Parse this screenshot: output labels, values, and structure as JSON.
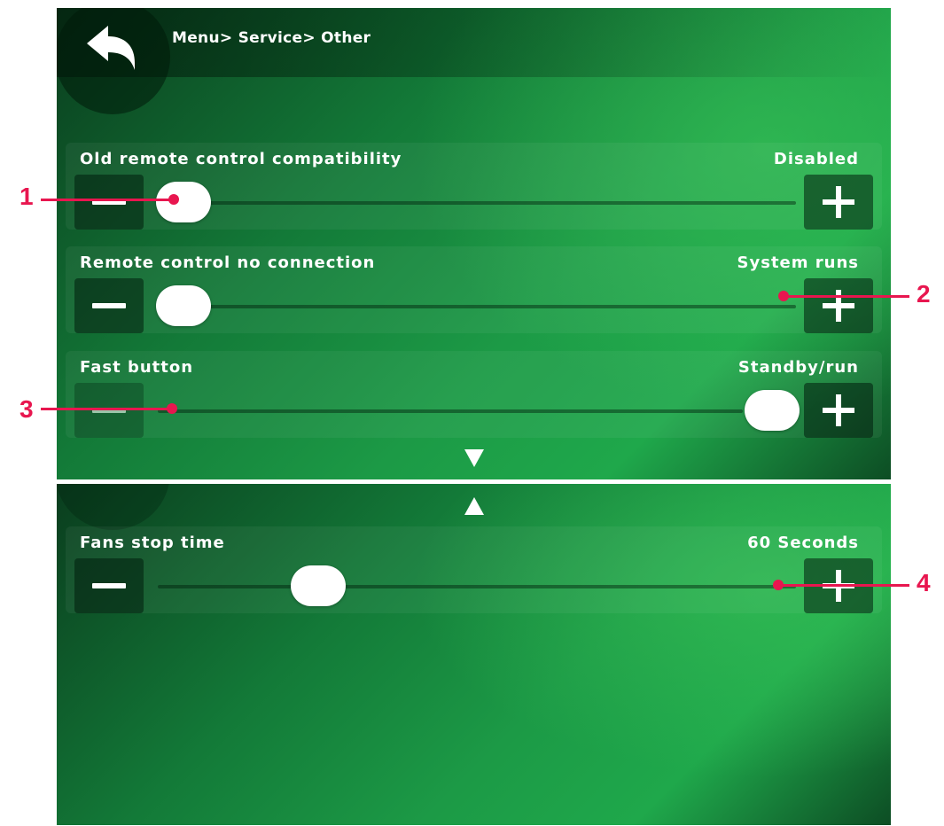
{
  "header": {
    "breadcrumb": "Menu> Service> Other"
  },
  "settings": [
    {
      "label": "Old remote control compatibility",
      "value": "Disabled"
    },
    {
      "label": "Remote control no connection",
      "value": "System runs"
    },
    {
      "label": "Fast button",
      "value": "Standby/run"
    },
    {
      "label": "Fans stop time",
      "value": "60 Seconds"
    }
  ],
  "annotations": [
    "1",
    "2",
    "3",
    "4"
  ],
  "colors": {
    "annotation": "#e8164f",
    "background": "#1a9a46"
  }
}
